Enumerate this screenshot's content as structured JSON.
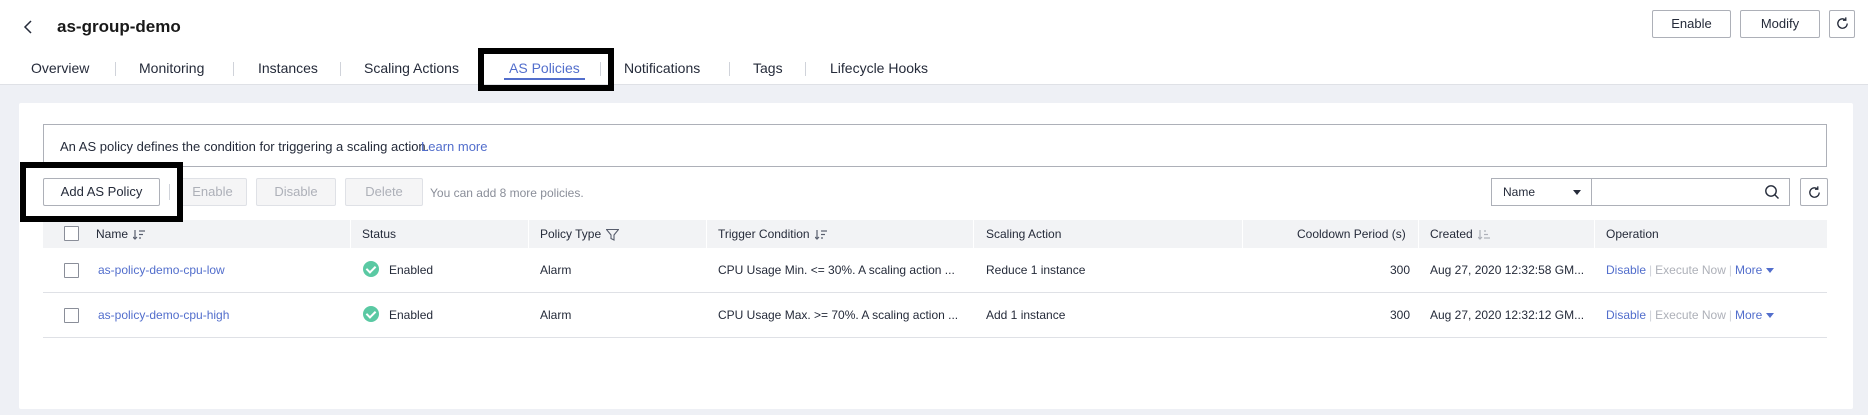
{
  "header": {
    "title": "as-group-demo",
    "enable_label": "Enable",
    "modify_label": "Modify"
  },
  "tabs": [
    {
      "label": "Overview"
    },
    {
      "label": "Monitoring"
    },
    {
      "label": "Instances"
    },
    {
      "label": "Scaling Actions"
    },
    {
      "label": "AS Policies",
      "active": true
    },
    {
      "label": "Notifications"
    },
    {
      "label": "Tags"
    },
    {
      "label": "Lifecycle Hooks"
    }
  ],
  "notice": {
    "text": "An AS policy defines the condition for triggering a scaling action.",
    "link": "Learn more"
  },
  "toolbar": {
    "add_label": "Add AS Policy",
    "enable_label": "Enable",
    "disable_label": "Disable",
    "delete_label": "Delete",
    "quota_text": "You can add 8 more policies.",
    "search_field": "Name",
    "search_value": ""
  },
  "table": {
    "columns": [
      "Name",
      "Status",
      "Policy Type",
      "Trigger Condition",
      "Scaling Action",
      "Cooldown Period (s)",
      "Created",
      "Operation"
    ],
    "rows": [
      {
        "name": "as-policy-demo-cpu-low",
        "status": "Enabled",
        "policy_type": "Alarm",
        "trigger": "CPU Usage Min. <= 30%. A scaling action ...",
        "action": "Reduce 1 instance",
        "cooldown": "300",
        "created": "Aug 27, 2020 12:32:58 GM...",
        "op_disable": "Disable",
        "op_execute": "Execute Now",
        "op_more": "More"
      },
      {
        "name": "as-policy-demo-cpu-high",
        "status": "Enabled",
        "policy_type": "Alarm",
        "trigger": "CPU Usage Max. >= 70%. A scaling action ...",
        "action": "Add 1 instance",
        "cooldown": "300",
        "created": "Aug 27, 2020 12:32:12 GM...",
        "op_disable": "Disable",
        "op_execute": "Execute Now",
        "op_more": "More"
      }
    ]
  },
  "colors": {
    "accent": "#526ecc",
    "status_enabled": "#5ac9a3",
    "highlight_box": "#000000"
  },
  "icons": [
    "chevron-left-icon",
    "refresh-icon",
    "sort-icon",
    "filter-icon",
    "search-icon",
    "check-circle-icon",
    "caret-down-icon"
  ]
}
